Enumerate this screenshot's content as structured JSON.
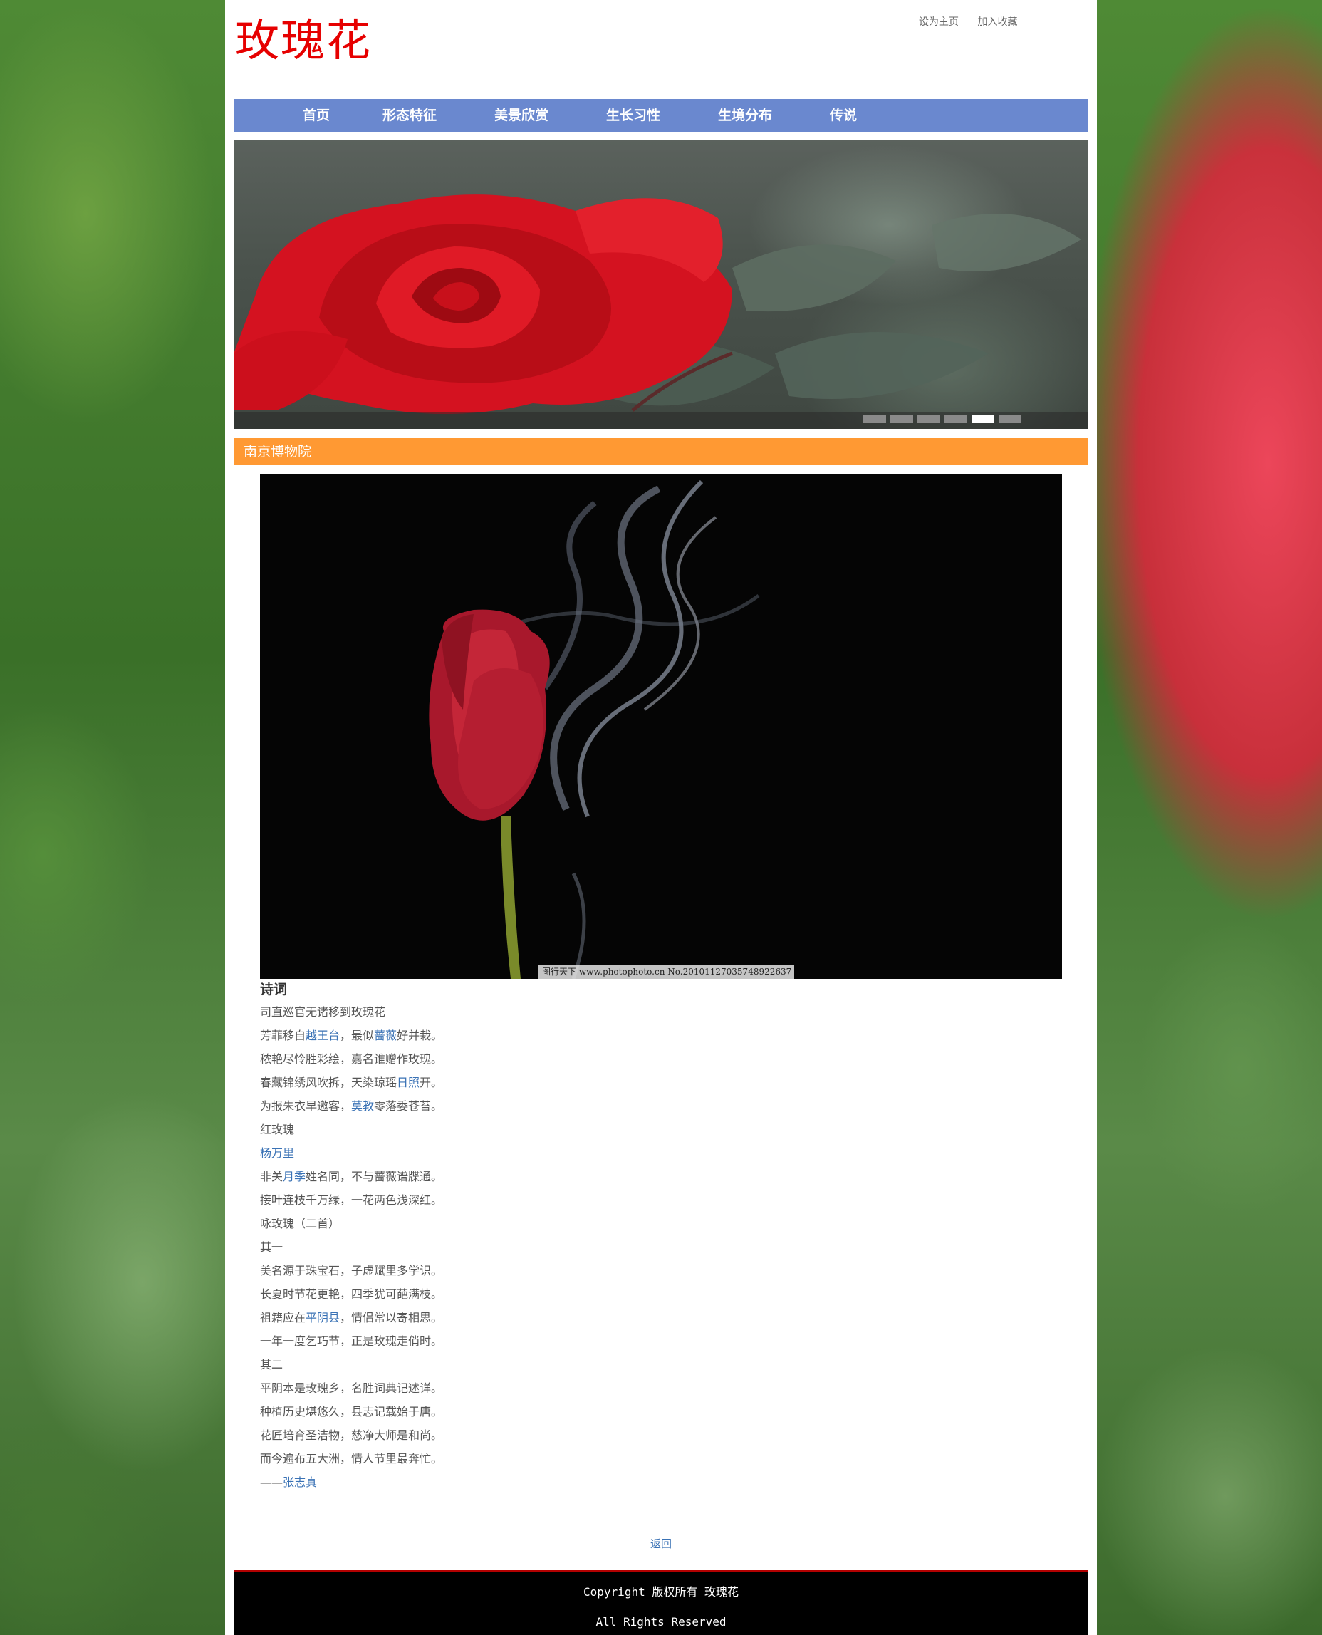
{
  "site": {
    "title": "玫瑰花",
    "top_links": [
      "设为主页",
      "加入收藏"
    ]
  },
  "nav": {
    "items": [
      "首页",
      "形态特征",
      "美景欣赏",
      "生长习性",
      "生境分布",
      "传说"
    ]
  },
  "banner": {
    "slide_count": 6,
    "active_index": 4
  },
  "section": {
    "title": "南京博物院"
  },
  "article": {
    "image_watermark": "图行天下 www.photophoto.cn No.20101127035748922637",
    "heading": "诗词",
    "lines": [
      [
        {
          "t": "司直巡官无诸移到玫瑰花"
        }
      ],
      [
        {
          "t": "芳菲移自"
        },
        {
          "t": "越王台",
          "link": true
        },
        {
          "t": "，最似"
        },
        {
          "t": "蔷薇",
          "link": true
        },
        {
          "t": "好并栽。"
        }
      ],
      [
        {
          "t": "秾艳尽怜胜彩绘，嘉名谁赠作玫瑰。"
        }
      ],
      [
        {
          "t": "春藏锦绣风吹拆，天染琼瑶"
        },
        {
          "t": "日照",
          "link": true
        },
        {
          "t": "开。"
        }
      ],
      [
        {
          "t": "为报朱衣早邀客，"
        },
        {
          "t": "莫教",
          "link": true
        },
        {
          "t": "零落委苍苔。"
        }
      ],
      [
        {
          "t": "红玫瑰"
        }
      ],
      [
        {
          "t": "杨万里",
          "link": true
        }
      ],
      [
        {
          "t": "非关"
        },
        {
          "t": "月季",
          "link": true
        },
        {
          "t": "姓名同，不与蔷薇谱牒通。"
        }
      ],
      [
        {
          "t": "接叶连枝千万绿，一花两色浅深红。"
        }
      ],
      [
        {
          "t": "咏玫瑰（二首）"
        }
      ],
      [
        {
          "t": "其一"
        }
      ],
      [
        {
          "t": "美名源于珠宝石，子虚赋里多学识。"
        }
      ],
      [
        {
          "t": "长夏时节花更艳，四季犹可葩满枝。"
        }
      ],
      [
        {
          "t": "祖籍应在"
        },
        {
          "t": "平阴县",
          "link": true
        },
        {
          "t": "，情侣常以寄相思。"
        }
      ],
      [
        {
          "t": "一年一度乞巧节，正是玫瑰走俏时。"
        }
      ],
      [
        {
          "t": "其二"
        }
      ],
      [
        {
          "t": "平阴本是玫瑰乡，名胜词典记述详。"
        }
      ],
      [
        {
          "t": "种植历史堪悠久，县志记载始于唐。"
        }
      ],
      [
        {
          "t": "花匠培育圣洁物，慈净大师是和尚。"
        }
      ],
      [
        {
          "t": "而今遍布五大洲，情人节里最奔忙。"
        }
      ],
      [
        {
          "t": "——"
        },
        {
          "t": "张志真",
          "link": true
        }
      ]
    ],
    "back_label": "返回"
  },
  "footer": {
    "line1": "Copyright 版权所有 玫瑰花",
    "line2": "All Rights Reserved"
  },
  "colors": {
    "title_red": "#e60000",
    "nav_blue": "#6a88cf",
    "section_orange": "#ff9933",
    "link_blue": "#3a72b5",
    "footer_border": "#b30000"
  }
}
